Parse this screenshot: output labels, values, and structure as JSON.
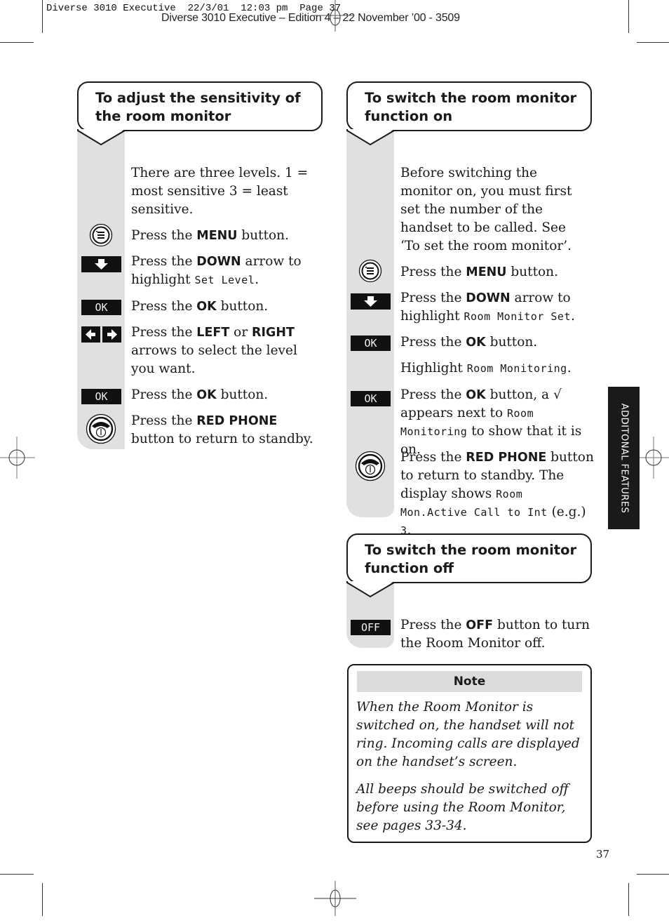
{
  "print_slug": "Diverse 3010 Executive  22/3/01  12:03 pm  Page 37",
  "edition_line": "Diverse 3010 Executive – Edition 4 – 22 November ’00 - 3509",
  "side_tab": "ADDITONAL FEATURES",
  "page_number": "37",
  "sections": {
    "sensitivity": {
      "title": "To adjust the sensitivity of the room monitor",
      "intro": "There are three levels. 1 = most sensitive 3 = least sensitive.",
      "steps": [
        {
          "icon": "menu-button-icon",
          "pre": "Press the ",
          "bold": "MENU",
          "post": " button."
        },
        {
          "icon": "down-arrow-key-icon",
          "pre": "Press the ",
          "bold": "DOWN",
          "post": " arrow to highlight ",
          "lcd": "Set Level",
          "tail": "."
        },
        {
          "icon": "ok-key-icon",
          "key": "OK",
          "pre": "Press the ",
          "bold": "OK",
          "post": " button."
        },
        {
          "icon": "left-right-arrow-keys-icon",
          "pre": "Press the ",
          "bold": "LEFT",
          "mid": " or ",
          "bold2": "RIGHT",
          "post": " arrows to select the level you want."
        },
        {
          "icon": "ok-key-icon",
          "key": "OK",
          "pre": "Press the ",
          "bold": "OK",
          "post": " button."
        },
        {
          "icon": "red-phone-button-icon",
          "pre": "Press the ",
          "bold": "RED PHONE",
          "post": " button to return to standby."
        }
      ]
    },
    "switch_on": {
      "title": "To switch the room monitor function on",
      "intro": "Before switching the monitor on, you must first set the number of the handset to be called. See ‘To set the room monitor’.",
      "steps": [
        {
          "icon": "menu-button-icon",
          "pre": "Press the ",
          "bold": "MENU",
          "post": " button."
        },
        {
          "icon": "down-arrow-key-icon",
          "pre": "Press the ",
          "bold": "DOWN",
          "post": " arrow to highlight ",
          "lcd": "Room Monitor Set",
          "tail": "."
        },
        {
          "icon": "ok-key-icon",
          "key": "OK",
          "pre": "Press the ",
          "bold": "OK",
          "post": " button."
        },
        {
          "pre": "Highlight ",
          "lcd": "Room Monitoring",
          "tail": "."
        },
        {
          "icon": "ok-key-icon",
          "key": "OK",
          "pre": "Press the ",
          "bold": "OK",
          "post": " button, a √ appears next to ",
          "lcd": "Room Monitoring",
          "tail": " to show that it is on."
        },
        {
          "icon": "red-phone-button-icon",
          "pre": "Press the ",
          "bold": "RED PHONE",
          "post": " button to return to standby. The display shows ",
          "lcd": "Room Mon.Active Call to Int",
          "mid": " (e.g.) ",
          "lcd2": "3",
          "tail": "."
        }
      ]
    },
    "switch_off": {
      "title": "To switch the room monitor function off",
      "steps": [
        {
          "icon": "off-key-icon",
          "key": "OFF",
          "pre": "Press the ",
          "bold": "OFF",
          "post": " button to turn the Room Monitor off."
        }
      ]
    }
  },
  "note": {
    "title": "Note",
    "paragraphs": [
      "When the Room Monitor is switched on, the handset will not ring. Incoming calls are displayed on the handset’s screen.",
      "All beeps should be switched off before using the Room Monitor, see pages 33-34."
    ]
  }
}
